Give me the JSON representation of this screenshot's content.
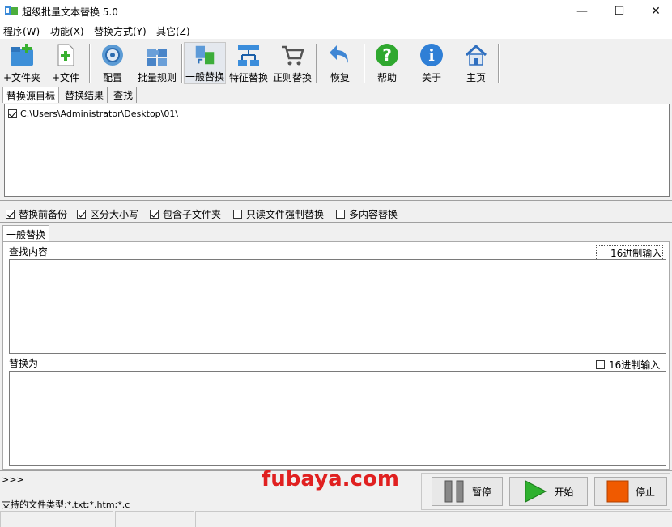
{
  "window": {
    "title": "超级批量文本替换 5.0",
    "minimize": "—",
    "maximize": "☐",
    "close": "✕"
  },
  "menu": [
    "程序(W)",
    "功能(X)",
    "替换方式(Y)",
    "其它(Z)"
  ],
  "toolbar": [
    {
      "label": "+文件夹",
      "icon": "folder-add-icon"
    },
    {
      "label": "+文件",
      "icon": "file-add-icon"
    },
    {
      "label": "配置",
      "icon": "gear-icon"
    },
    {
      "label": "批量规则",
      "icon": "puzzle-icon"
    },
    {
      "label": "一般替换",
      "icon": "swap-icon"
    },
    {
      "label": "特征替换",
      "icon": "network-icon"
    },
    {
      "label": "正则替换",
      "icon": "cart-icon"
    },
    {
      "label": "恢复",
      "icon": "undo-icon"
    },
    {
      "label": "帮助",
      "icon": "help-icon"
    },
    {
      "label": "关于",
      "icon": "info-icon"
    },
    {
      "label": "主页",
      "icon": "home-icon"
    }
  ],
  "tabs": [
    "替换源目标",
    "替换结果",
    "查找"
  ],
  "targets": [
    {
      "path": "C:\\Users\\Administrator\\Desktop\\01\\",
      "checked": true
    }
  ],
  "options": [
    {
      "label": "替换前备份",
      "checked": true
    },
    {
      "label": "区分大小写",
      "checked": true
    },
    {
      "label": "包含子文件夹",
      "checked": true
    },
    {
      "label": "只读文件强制替换",
      "checked": false
    },
    {
      "label": "多内容替换",
      "checked": false
    }
  ],
  "mode_tab": "一般替换",
  "find": {
    "label": "查找内容",
    "hex_label": "16进制输入",
    "hex_checked": false,
    "value": ""
  },
  "replace": {
    "label": "替换为",
    "hex_label": "16进制输入",
    "hex_checked": false,
    "value": ""
  },
  "log_prefix": ">>>",
  "watermark": "fubaya.com",
  "supported_types": "支持的文件类型:*.txt;*.htm;*.c",
  "controls": {
    "pause": "暂停",
    "start": "开始",
    "stop": "停止"
  },
  "colors": {
    "watermark": "#e02020",
    "start_green": "#2fb12f",
    "stop_orange": "#f05a00"
  }
}
